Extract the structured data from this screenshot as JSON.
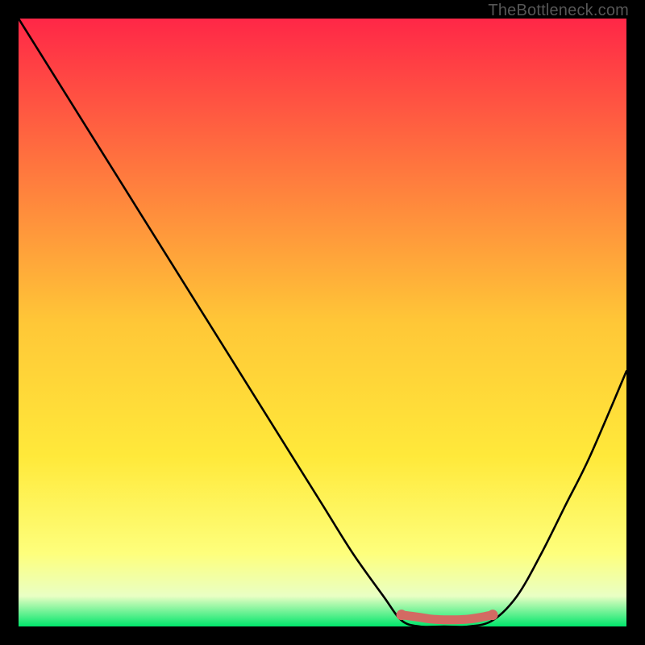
{
  "watermark": "TheBottleneck.com",
  "colors": {
    "frame": "#000000",
    "grad_top": "#ff2747",
    "grad_mid1": "#ff6e3f",
    "grad_mid2": "#ffc737",
    "grad_mid3": "#ffe93a",
    "grad_bot1": "#feff7c",
    "grad_bot2": "#e9ffc4",
    "grad_bottom": "#00e66b",
    "curve": "#000000",
    "mark": "#d36a63"
  },
  "chart_data": {
    "type": "line",
    "title": "",
    "xlabel": "",
    "ylabel": "",
    "xlim": [
      0,
      100
    ],
    "ylim": [
      0,
      100
    ],
    "series": [
      {
        "name": "bottleneck-curve",
        "x": [
          0,
          5,
          10,
          15,
          20,
          25,
          30,
          35,
          40,
          45,
          50,
          55,
          60,
          63,
          66,
          70,
          74,
          78,
          82,
          86,
          90,
          94,
          100
        ],
        "values": [
          100,
          92,
          84,
          76,
          68,
          60,
          52,
          44,
          36,
          28,
          20,
          12,
          5,
          1,
          0,
          0,
          0,
          1,
          5,
          12,
          20,
          28,
          42
        ]
      },
      {
        "name": "optimal-range-marker",
        "x": [
          63,
          66,
          68,
          70,
          72,
          74,
          76,
          78
        ],
        "values": [
          1.9,
          1.5,
          1.2,
          1.1,
          1.1,
          1.2,
          1.5,
          1.9
        ]
      }
    ],
    "annotations": [
      {
        "text": "TheBottleneck.com",
        "pos": "top-right"
      }
    ]
  }
}
